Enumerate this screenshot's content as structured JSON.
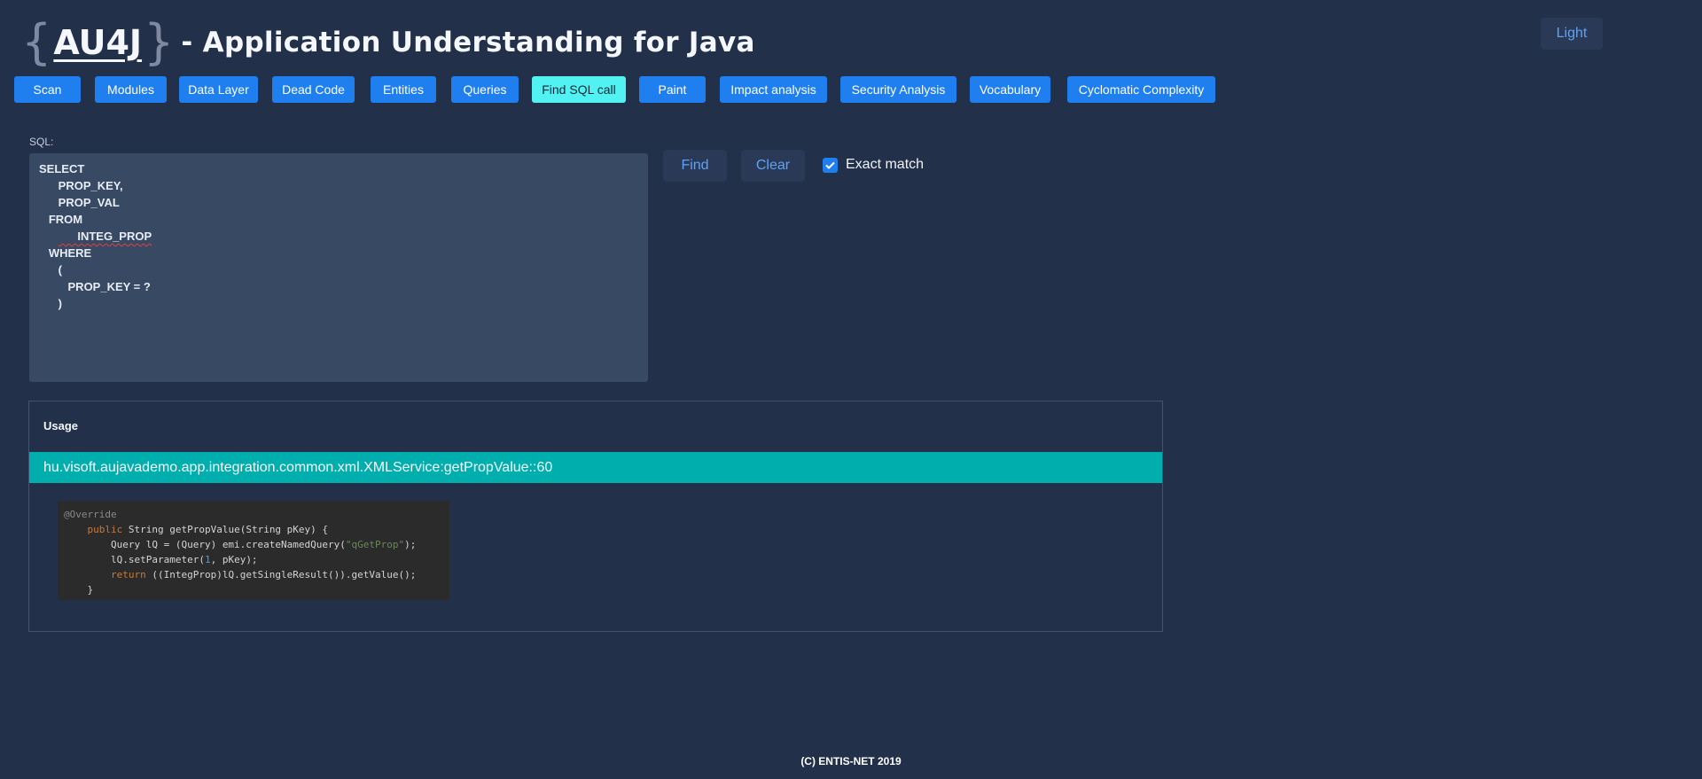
{
  "header": {
    "logo": {
      "brace_open": "{",
      "text": "AU4J",
      "brace_close": "}"
    },
    "title": "- Application Understanding for Java",
    "theme_toggle": "Light"
  },
  "nav": {
    "items": [
      {
        "label": "Scan",
        "active": false
      },
      {
        "label": "Modules",
        "active": false
      },
      {
        "label": "Data Layer",
        "active": false
      },
      {
        "label": "Dead Code",
        "active": false
      },
      {
        "label": "Entities",
        "active": false
      },
      {
        "label": "Queries",
        "active": false
      },
      {
        "label": "Find SQL call",
        "active": true
      },
      {
        "label": "Paint",
        "active": false
      },
      {
        "label": "Impact analysis",
        "active": false
      },
      {
        "label": "Security Analysis",
        "active": false
      },
      {
        "label": "Vocabulary",
        "active": false
      },
      {
        "label": "Cyclomatic Complexity",
        "active": false
      }
    ]
  },
  "sql": {
    "label": "SQL:",
    "lines": [
      "SELECT",
      "      PROP_KEY,",
      "      PROP_VAL",
      "   FROM",
      "      INTEG_PROP",
      "   WHERE",
      "      (",
      "         PROP_KEY = ?",
      "      )"
    ]
  },
  "actions": {
    "find": "Find",
    "clear": "Clear",
    "exact_match": {
      "label": "Exact match",
      "checked": true
    }
  },
  "usage": {
    "title": "Usage",
    "result": "hu.visoft.aujavademo.app.integration.common.xml.XMLService:getPropValue::60",
    "code": {
      "annotation": "@Override",
      "line2_kw": "public",
      "line2_rest": " String getPropValue(String pKey) {",
      "line3_pre": "Query lQ = (Query) emi.createNamedQuery(",
      "line3_str": "\"qGetProp\"",
      "line3_post": ");",
      "line4_pre": "lQ.setParameter(",
      "line4_num": "1",
      "line4_post": ", pKey);",
      "line5_kw": "return",
      "line5_rest": " ((IntegProp)lQ.getSingleResult()).getValue();",
      "line6": "}"
    }
  },
  "footer": {
    "text": "(C) ENTIS-NET 2019"
  },
  "colors": {
    "background": "#223049",
    "nav_button": "#1f7fee",
    "nav_active": "#52f2f2",
    "result_row": "#00aeae",
    "secondary_button_text": "#5ea2f5"
  }
}
